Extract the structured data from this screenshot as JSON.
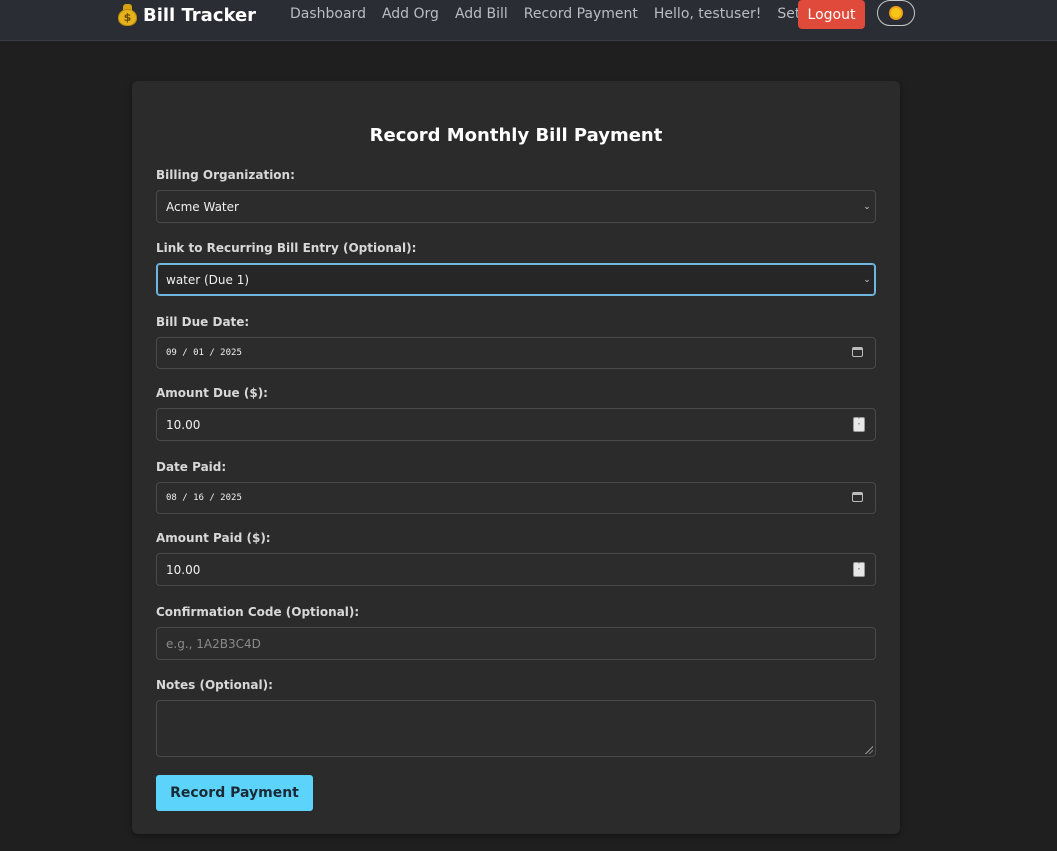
{
  "header": {
    "brand": "Bill Tracker",
    "brand_icon": "money-bag-icon",
    "nav": [
      "Dashboard",
      "Add Org",
      "Add Bill",
      "Record Payment",
      "Hello, testuser!",
      "Settings"
    ],
    "logout_label": "Logout",
    "theme_icon": "sun-icon",
    "colors": {
      "logout": "#e04a3b",
      "sun": "#f7c614"
    }
  },
  "form": {
    "title": "Record Monthly Bill Payment",
    "org_label": "Billing Organization:",
    "org_value": "Acme Water",
    "link_label": "Link to Recurring Bill Entry (Optional):",
    "link_value": "water (Due 1)",
    "due_date_label": "Bill Due Date:",
    "due_date_value": "09 / 01 / 2025",
    "amount_due_label": "Amount Due ($):",
    "amount_due_value": "10.00",
    "date_paid_label": "Date Paid:",
    "date_paid_value": "08 / 16 / 2025",
    "amount_paid_label": "Amount Paid ($):",
    "amount_paid_value": "10.00",
    "confirmation_label": "Confirmation Code (Optional):",
    "confirmation_placeholder": "e.g., 1A2B3C4D",
    "notes_label": "Notes (Optional):",
    "submit_label": "Record Payment",
    "colors": {
      "submit": "#5bd3fb",
      "focus": "#6fb6e0"
    }
  }
}
